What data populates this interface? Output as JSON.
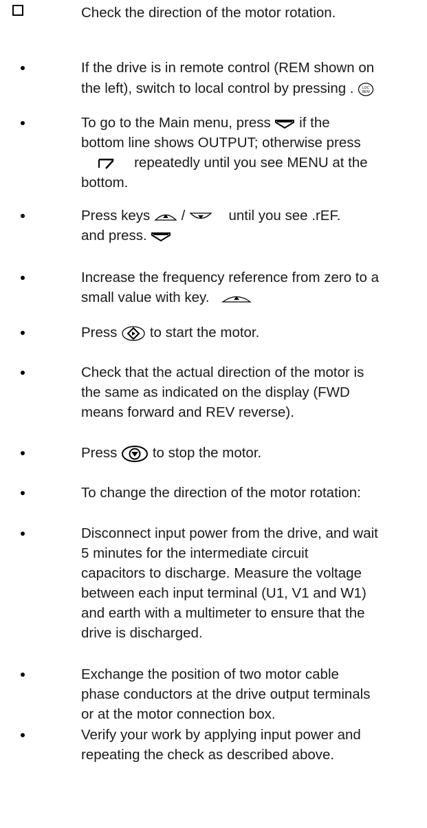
{
  "heading": {
    "text": "Check the direction of the motor rotation."
  },
  "steps": [
    {
      "a": "If the drive is in remote control (REM shown on",
      "b": "the left), switch to local control by pressing .",
      "icon": "loc-rem-key-icon"
    },
    {
      "a": "To go to the Main menu, press",
      "a2": "if the",
      "b": "bottom line shows OUTPUT; otherwise press",
      "c2": "repeatedly until you see MENU at the",
      "d": "bottom."
    },
    {
      "a": "Press keys",
      "a_sep": "/",
      "a2": "until you see .rEF.",
      "b": "and press."
    },
    {
      "a": "Increase the frequency reference from zero to a",
      "b": "small value with key."
    },
    {
      "a": "Press",
      "a2": "to start the motor."
    },
    {
      "a": "Check that the actual direction of the motor is",
      "b": "the same as indicated on the display (FWD",
      "c": "means forward and REV reverse)."
    },
    {
      "a": "Press",
      "a2": "to stop the motor."
    },
    {
      "a": "To change the direction of the motor rotation:"
    },
    {
      "a": "Disconnect input power from the drive, and wait",
      "b": "5 minutes for the intermediate circuit",
      "c": "capacitors to discharge. Measure the voltage",
      "d": "between each input terminal (U1, V1 and W1)",
      "e": "and earth with a multimeter to ensure that the",
      "f": "drive is discharged."
    },
    {
      "a": "Exchange the position of two motor cable",
      "b": "phase conductors at the drive output terminals",
      "c": "or at the motor connection box."
    },
    {
      "a": "Verify your work by applying input power and",
      "b": "repeating the check as described above."
    }
  ],
  "icons": {
    "loc_rem_label_top": "LOC",
    "loc_rem_label_bottom": "REM"
  }
}
